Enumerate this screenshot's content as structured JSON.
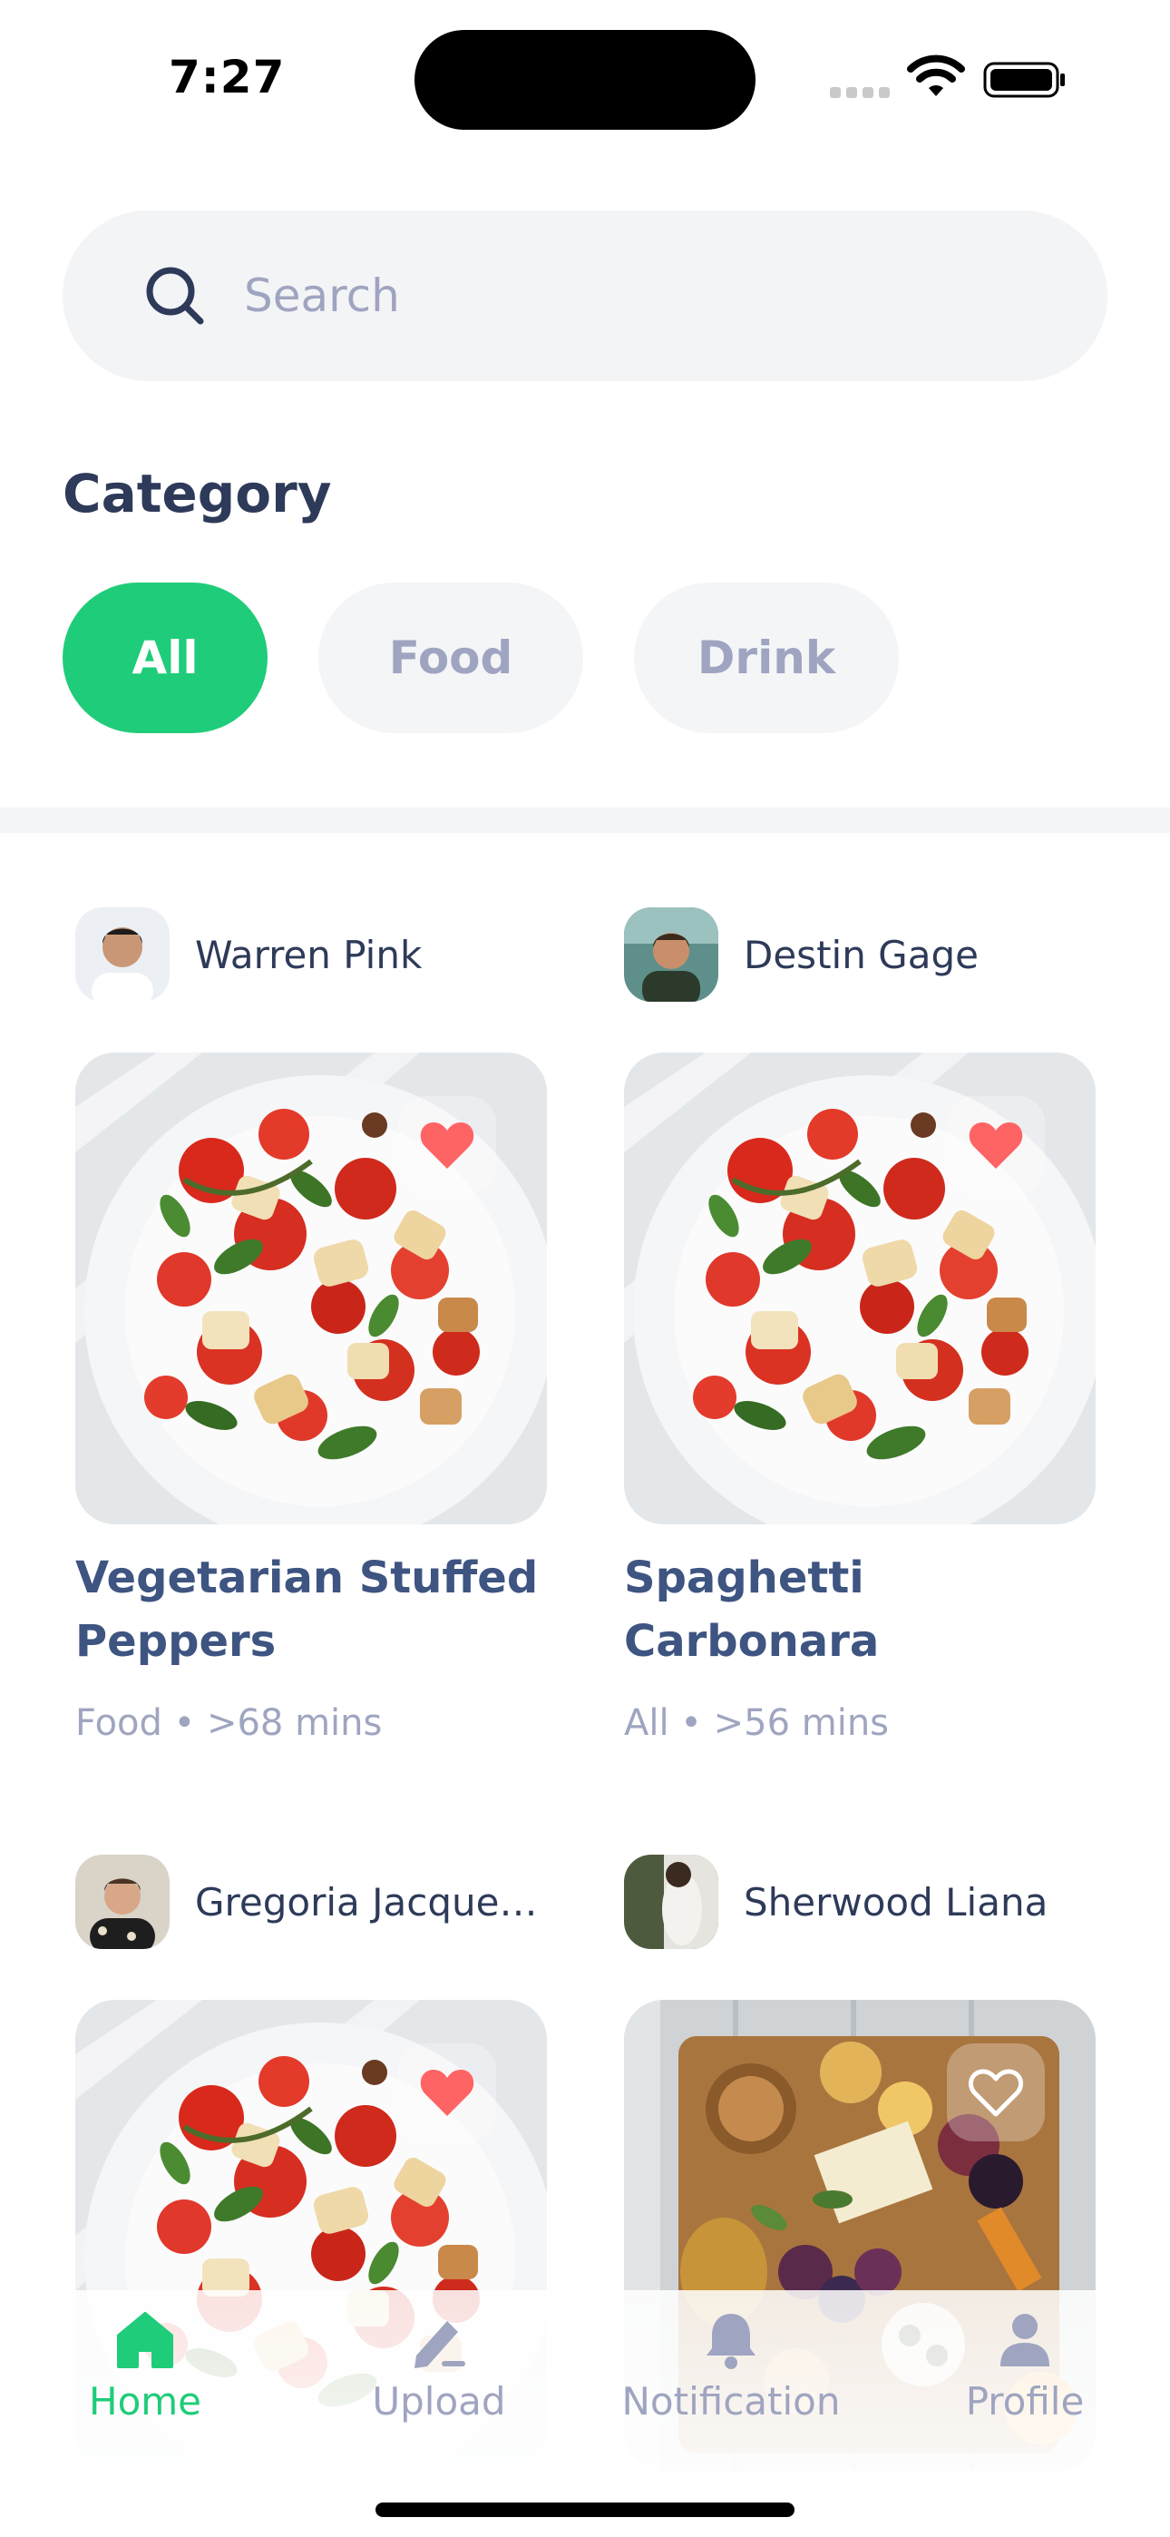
{
  "status_bar": {
    "time": "7:27"
  },
  "search": {
    "placeholder": "Search",
    "value": ""
  },
  "category": {
    "title": "Category",
    "chips": [
      {
        "label": "All",
        "selected": true
      },
      {
        "label": "Food",
        "selected": false
      },
      {
        "label": "Drink",
        "selected": false
      }
    ]
  },
  "recipes": [
    {
      "author": "Warren Pink",
      "title": "Vegetarian Stuffed Peppers",
      "meta": "Food • >68 mins",
      "liked": true,
      "image": "tomato-bread-salad"
    },
    {
      "author": "Destin Gage",
      "title": "Spaghetti Carbonara",
      "meta": "All • >56 mins",
      "liked": true,
      "image": "tomato-bread-salad"
    },
    {
      "author": "Gregoria Jacquelyn",
      "title": "",
      "meta": "",
      "liked": true,
      "image": "tomato-bread-salad"
    },
    {
      "author": "Sherwood Liana",
      "title": "",
      "meta": "",
      "liked": false,
      "image": "charcuterie-board"
    }
  ],
  "bottom_nav": [
    {
      "label": "Home",
      "icon": "home-icon",
      "active": true
    },
    {
      "label": "Upload",
      "icon": "pencil-icon",
      "active": false
    },
    {
      "label": "Notification",
      "icon": "bell-icon",
      "active": false
    },
    {
      "label": "Profile",
      "icon": "person-icon",
      "active": false
    }
  ],
  "colors": {
    "accent": "#1fcc79",
    "title_text": "#2e3a59",
    "recipe_title": "#3e5481",
    "muted_text": "#9fa5c0",
    "heart": "#ff6464",
    "chip_background": "#f4f5f7"
  }
}
